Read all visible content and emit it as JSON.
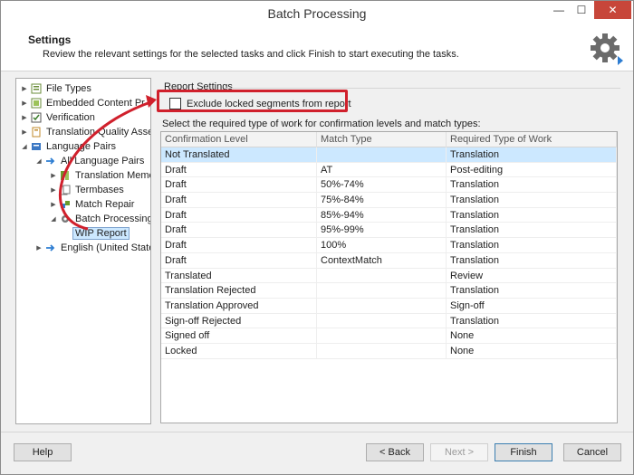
{
  "window": {
    "title": "Batch Processing",
    "min_glyph": "—",
    "max_glyph": "☐",
    "close_glyph": "✕"
  },
  "header": {
    "title": "Settings",
    "description": "Review the relevant settings for the selected tasks and click Finish to start executing the tasks."
  },
  "tree": {
    "items": [
      {
        "label": "File Types",
        "icon": "file-types-icon"
      },
      {
        "label": "Embedded Content Pr",
        "icon": "embedded-content-icon"
      },
      {
        "label": "Verification",
        "icon": "verification-icon"
      },
      {
        "label": "Translation Quality Asses",
        "icon": "tqa-icon"
      },
      {
        "label": "Language Pairs",
        "icon": "language-pairs-icon"
      },
      {
        "label": "All Language Pairs",
        "icon": "arrow-right-icon"
      },
      {
        "label": "Translation Memo",
        "icon": "translation-memory-icon"
      },
      {
        "label": "Termbases",
        "icon": "termbases-icon"
      },
      {
        "label": "Match Repair",
        "icon": "match-repair-icon"
      },
      {
        "label": "Batch Processing",
        "icon": "gear-icon"
      },
      {
        "label": "WIP Report",
        "icon": "report-icon"
      },
      {
        "label": "English (United State",
        "icon": "arrow-right-icon"
      }
    ]
  },
  "report_settings": {
    "section_title": "Report Settings",
    "exclude_locked_label": "Exclude locked segments from report",
    "exclude_locked_checked": false,
    "select_label": "Select the required type of work for confirmation levels and match types:"
  },
  "grid": {
    "columns": [
      "Confirmation Level",
      "Match Type",
      "Required Type of Work"
    ],
    "rows": [
      [
        "Not Translated",
        "",
        "Translation"
      ],
      [
        "Draft",
        "AT",
        "Post-editing"
      ],
      [
        "Draft",
        "50%-74%",
        "Translation"
      ],
      [
        "Draft",
        "75%-84%",
        "Translation"
      ],
      [
        "Draft",
        "85%-94%",
        "Translation"
      ],
      [
        "Draft",
        "95%-99%",
        "Translation"
      ],
      [
        "Draft",
        "100%",
        "Translation"
      ],
      [
        "Draft",
        "ContextMatch",
        "Translation"
      ],
      [
        "Translated",
        "",
        "Review"
      ],
      [
        "Translation Rejected",
        "",
        "Translation"
      ],
      [
        "Translation Approved",
        "",
        "Sign-off"
      ],
      [
        "Sign-off Rejected",
        "",
        "Translation"
      ],
      [
        "Signed off",
        "",
        "None"
      ],
      [
        "Locked",
        "",
        "None"
      ]
    ]
  },
  "footer": {
    "help": "Help",
    "back": "< Back",
    "next": "Next >",
    "finish": "Finish",
    "cancel": "Cancel"
  },
  "colors": {
    "accent": "#cce8ff",
    "annotation": "#d0202c"
  }
}
